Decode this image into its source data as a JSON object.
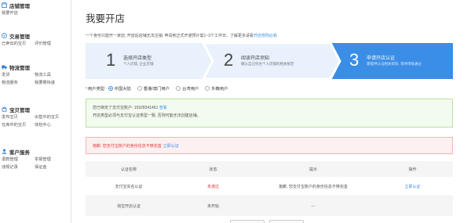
{
  "sidebar": {
    "sections": [
      {
        "key": "shop",
        "title": "店铺管理",
        "icon": "shop-icon",
        "color": "#2f7fd8",
        "items": [
          "我要开店"
        ]
      },
      {
        "key": "trade",
        "title": "交易管理",
        "icon": "trade-icon",
        "color": "#2f7fd8",
        "items": [
          "已卖出的宝贝",
          "评价管理"
        ]
      },
      {
        "key": "logistics",
        "title": "物流管理",
        "icon": "truck-icon",
        "color": "#2f7fd8",
        "items": [
          "发货",
          "物流工具",
          "物流服务",
          "我要寄快递"
        ]
      },
      {
        "key": "goods",
        "title": "宝贝管理",
        "icon": "goods-icon",
        "color": "#2f7fd8",
        "items": [
          "发布宝贝",
          "出售中的宝贝",
          "仓库中的宝贝",
          "体检中心"
        ]
      },
      {
        "key": "service",
        "title": "客户服务",
        "icon": "service-icon",
        "color": "#2f7fd8",
        "items": [
          "退款管理",
          "举报管理",
          "违规记录",
          "保证金"
        ]
      }
    ]
  },
  "main": {
    "title": "我要开店",
    "intro": "一个身份只能开一家店; 开店后店铺无法注销; 申请到正式开通预计需1~3个工作日。了解更多请看",
    "intro_link": "开店规则必看",
    "steps": [
      {
        "num": "1",
        "title": "选择开店类型",
        "desc": "个人店铺, 企业店铺"
      },
      {
        "num": "2",
        "title": "阅读开店须知",
        "desc": "确认自己符合个人店铺的相关规定"
      },
      {
        "num": "3",
        "title": "申请开店认证",
        "desc": "需提供认证相关资料, 等待审核通过"
      }
    ],
    "user_type": {
      "label": "用户类型:",
      "options": [
        "中国大陆",
        "香港/澳门用户",
        "台湾用户",
        "外籍用户"
      ],
      "selected": "中国大陆"
    },
    "notice_green": {
      "line1_prefix": "您已绑定了支付宝账户: 15928341461",
      "line1_link": "查看",
      "line2": "开店类型必须与支付宝认证类型一致, 否则可能无法创建店铺。"
    },
    "notice_red": {
      "text": "抱歉, 您支付宝账户的身份信息不够完善",
      "link": "立即认证"
    },
    "table": {
      "headers": [
        "认证名称",
        "状态",
        "提示",
        "操作"
      ],
      "rows": [
        {
          "name": "支付宝实名认证",
          "status": "未通过",
          "tip": "抱歉, 您支付宝账户的身份信息不够完善",
          "action": "立即认证"
        },
        {
          "name": "淘宝开店认证",
          "status": "未开始",
          "tip": "---",
          "action": ""
        }
      ]
    }
  },
  "colors": {
    "accent": "#3a8ee6",
    "step_active": "#3a8ee6",
    "step_inactive": "#e8f1fc",
    "error": "#e4393c"
  }
}
